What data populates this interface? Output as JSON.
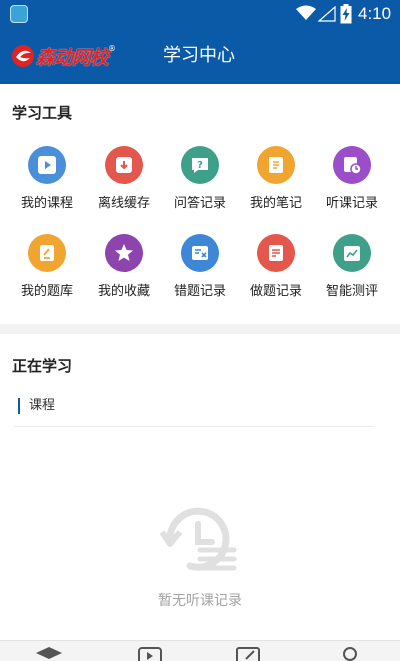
{
  "status_bar": {
    "time": "4:10"
  },
  "app_bar": {
    "logo_text": "森动网校",
    "logo_reg": "®",
    "title": "学习中心"
  },
  "tools": {
    "title": "学习工具",
    "items": [
      {
        "label": "我的课程",
        "icon": "play-video-icon",
        "color": "#4a90d9"
      },
      {
        "label": "离线缓存",
        "icon": "download-cache-icon",
        "color": "#e4574c"
      },
      {
        "label": "问答记录",
        "icon": "question-chat-icon",
        "color": "#3fa08a"
      },
      {
        "label": "我的笔记",
        "icon": "notebook-icon",
        "color": "#f0a531"
      },
      {
        "label": "听课记录",
        "icon": "listen-history-icon",
        "color": "#9b4dca"
      },
      {
        "label": "我的题库",
        "icon": "question-bank-icon",
        "color": "#f0a531"
      },
      {
        "label": "我的收藏",
        "icon": "star-icon",
        "color": "#8e44ad"
      },
      {
        "label": "错题记录",
        "icon": "wrong-answer-icon",
        "color": "#3e87d6"
      },
      {
        "label": "做题记录",
        "icon": "exercise-record-icon",
        "color": "#e4574c"
      },
      {
        "label": "智能测评",
        "icon": "smart-eval-icon",
        "color": "#3fa08a"
      }
    ]
  },
  "learning": {
    "title": "正在学习",
    "tab": "课程",
    "empty_text": "暂无听课记录"
  }
}
